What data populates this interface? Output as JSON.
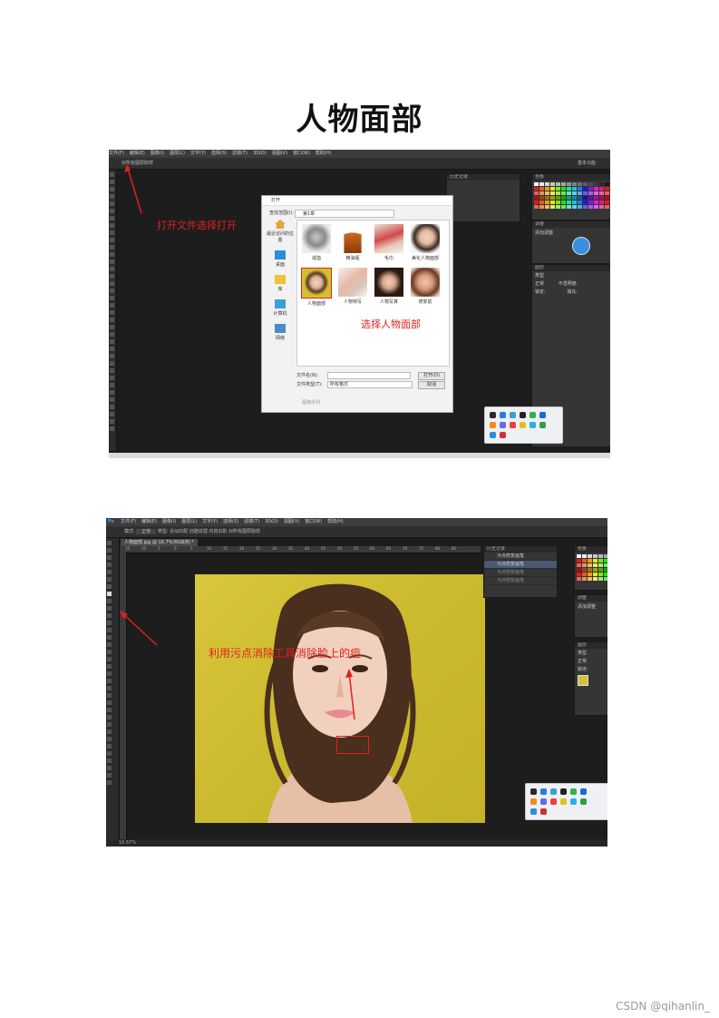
{
  "page_title": "人物面部",
  "screenshot1": {
    "menu_items": [
      "文件(F)",
      "编辑(E)",
      "图像(I)",
      "图层(L)",
      "文字(Y)",
      "选择(S)",
      "滤镜(T)",
      "3D(D)",
      "视图(V)",
      "窗口(W)",
      "帮助(H)"
    ],
    "options_label": "对所有图层取样",
    "workspace_label": "基本功能",
    "history_panel_title": "历史记录",
    "swatches_tab": "色板",
    "adjust_tab": "调整",
    "adjust_label": "添加调整",
    "layers_tab": "图层",
    "layers_kind": "类型",
    "layers_mode": "正常",
    "layers_opacity": "不透明度:",
    "layers_lock": "锁定:",
    "layers_fill": "填充:",
    "annotation_open": "打开文件选择打开",
    "annotation_select": "选择人物面部",
    "dialog": {
      "title": "打开",
      "look_in_label": "查找范围(I):",
      "look_in_value": "第1章",
      "sidebar": [
        "最近访问的位置",
        "桌面",
        "库",
        "计算机",
        "网络"
      ],
      "files": [
        "戒指",
        "精油瓶",
        "毛巾",
        "美化人物面部",
        "人物面部",
        "人物特写",
        "人物写真",
        "修复前"
      ],
      "filename_label": "文件名(N):",
      "filetype_label": "文件类型(T):",
      "filetype_value": "所有格式",
      "open_button": "打开(O)",
      "cancel_button": "取消",
      "sequence_label": "图像序列"
    }
  },
  "screenshot2": {
    "app_logo": "Ps",
    "menu_items": [
      "文件(F)",
      "编辑(E)",
      "图像(I)",
      "图层(L)",
      "文字(Y)",
      "选择(S)",
      "滤镜(T)",
      "3D(D)",
      "视图(V)",
      "窗口(W)",
      "帮助(H)"
    ],
    "options": {
      "mode_label": "模式:",
      "mode_value": "正常",
      "type_label": "类型:",
      "type_options": [
        "近似匹配",
        "创建纹理",
        "内容识别"
      ],
      "sample_all": "对所有图层取样"
    },
    "doc_tab": "人物面部.jpg @ 16.7%(RGB/8) *",
    "zoom": "16.67%",
    "ruler_ticks": [
      "15",
      "10",
      "5",
      "0",
      "5",
      "10",
      "15",
      "20",
      "25",
      "30",
      "35",
      "40",
      "45",
      "50",
      "55",
      "60",
      "65",
      "70",
      "75",
      "80",
      "85"
    ],
    "history_panel_title": "历史记录",
    "history_items": [
      "污点修复画笔",
      "污点修复画笔",
      "污点修复画笔",
      "污点修复画笔"
    ],
    "swatches_tab": "色板",
    "adjust_tab": "调整",
    "adjust_label": "添加调整",
    "layers_tab": "图层",
    "layers_kind": "类型",
    "layers_mode": "正常",
    "layers_lock": "锁定:",
    "annotation_spot": "利用污点消除工具消除脸上的痘"
  },
  "watermark": "CSDN @qihanlin_",
  "colors": {
    "annotation": "#e02020",
    "ps_background": "#1d1d1d",
    "panel": "#353535",
    "photo_background": "#d4c234"
  }
}
